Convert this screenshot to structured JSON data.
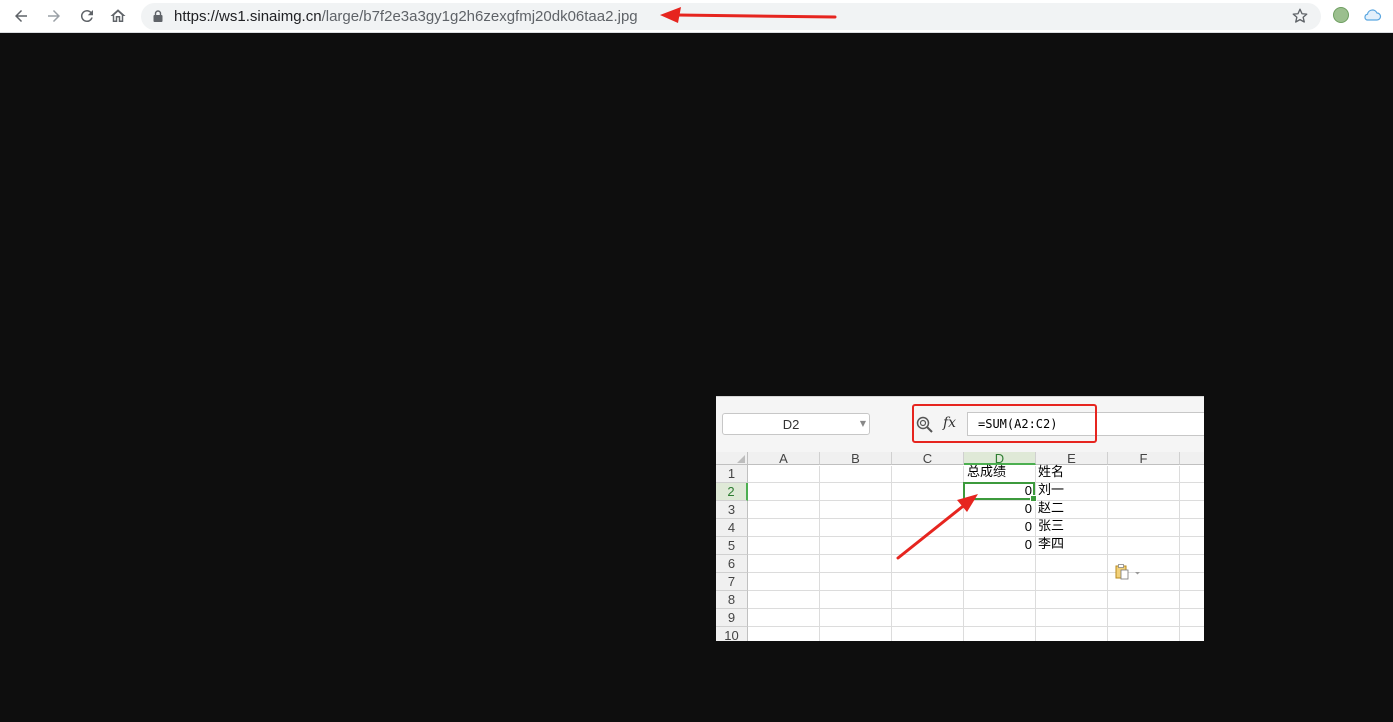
{
  "browser": {
    "url_host": "https://ws1.sinaimg.cn",
    "url_path": "/large/b7f2e3a3gy1g2h6zexgfmj20dk06taa2.jpg"
  },
  "spreadsheet": {
    "name_box": "D2",
    "formula": "=SUM(A2:C2)",
    "fx_label": "fx",
    "columns": [
      "A",
      "B",
      "C",
      "D",
      "E",
      "F"
    ],
    "rows": [
      "1",
      "2",
      "3",
      "4",
      "5",
      "6",
      "7",
      "8",
      "9",
      "10"
    ],
    "cells": {
      "D1": "总成绩",
      "E1": "姓名",
      "D2": "0",
      "E2": "刘一",
      "D3": "0",
      "E3": "赵二",
      "D4": "0",
      "E4": "张三",
      "D5": "0",
      "E5": "李四"
    },
    "active_cell": "D2"
  },
  "colors": {
    "annotation": "#e6251f",
    "selection": "#3c9a3c",
    "page_background": "#0e0e0e"
  }
}
